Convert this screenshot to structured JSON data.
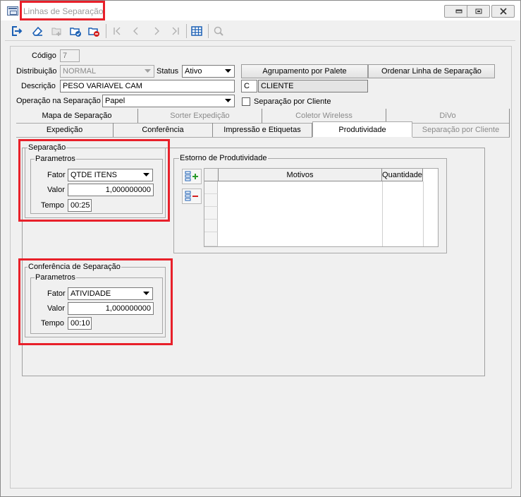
{
  "window": {
    "title": "Linhas de Separação",
    "minimize_icon": "minimize-icon",
    "restore_icon": "restore-icon",
    "close_icon": "close-icon"
  },
  "toolbar": {
    "icons": [
      "exit-icon",
      "eraser-icon",
      "new-record-icon",
      "save-record-icon",
      "delete-record-icon",
      "first-icon",
      "previous-icon",
      "next-icon",
      "last-icon",
      "table-icon",
      "search-icon"
    ]
  },
  "form": {
    "codigo_label": "Código",
    "codigo_value": "7",
    "distribuicao_label": "Distribuição",
    "distribuicao_value": "NORMAL",
    "status_label": "Status",
    "status_value": "Ativo",
    "agrupamento_button": "Agrupamento por Palete",
    "ordenar_button": "Ordenar Linha de Separação",
    "descricao_label": "Descrição",
    "descricao_value": "PESO VARIAVEL CAM",
    "tipo_code": "C",
    "tipo_value": "CLIENTE",
    "operacao_label": "Operação na Separação",
    "operacao_value": "Papel",
    "separacao_cliente_label": "Separação por Cliente",
    "separacao_cliente_checked": false
  },
  "tabs_row1": [
    "Mapa de Separação",
    "Sorter Expedição",
    "Coletor Wireless",
    "DiVo"
  ],
  "tabs_row2": [
    "Expedição",
    "Conferência",
    "Impressão e Etiquetas",
    "Produtividade",
    "Separação por Cliente"
  ],
  "active_tab": "Produtividade",
  "separacao": {
    "title": "Separação",
    "params_title": "Parametros",
    "fator_label": "Fator",
    "fator_value": "QTDE ITENS",
    "valor_label": "Valor",
    "valor_value": "1,000000000",
    "tempo_label": "Tempo",
    "tempo_value": "00:25"
  },
  "estorno": {
    "title": "Estorno de Produtividade",
    "columns": [
      "Motivos",
      "Quantidade"
    ],
    "add_icon": "add-row-icon",
    "remove_icon": "remove-row-icon"
  },
  "conferencia": {
    "title": "Conferência de Separação",
    "params_title": "Parametros",
    "fator_label": "Fator",
    "fator_value": "ATIVIDADE",
    "valor_label": "Valor",
    "valor_value": "1,000000000",
    "tempo_label": "Tempo",
    "tempo_value": "00:10"
  },
  "colors": {
    "highlight": "#e8202a",
    "accent_blue": "#1a5fb4",
    "accent_green": "#2a9a2a",
    "accent_red": "#d42020"
  }
}
